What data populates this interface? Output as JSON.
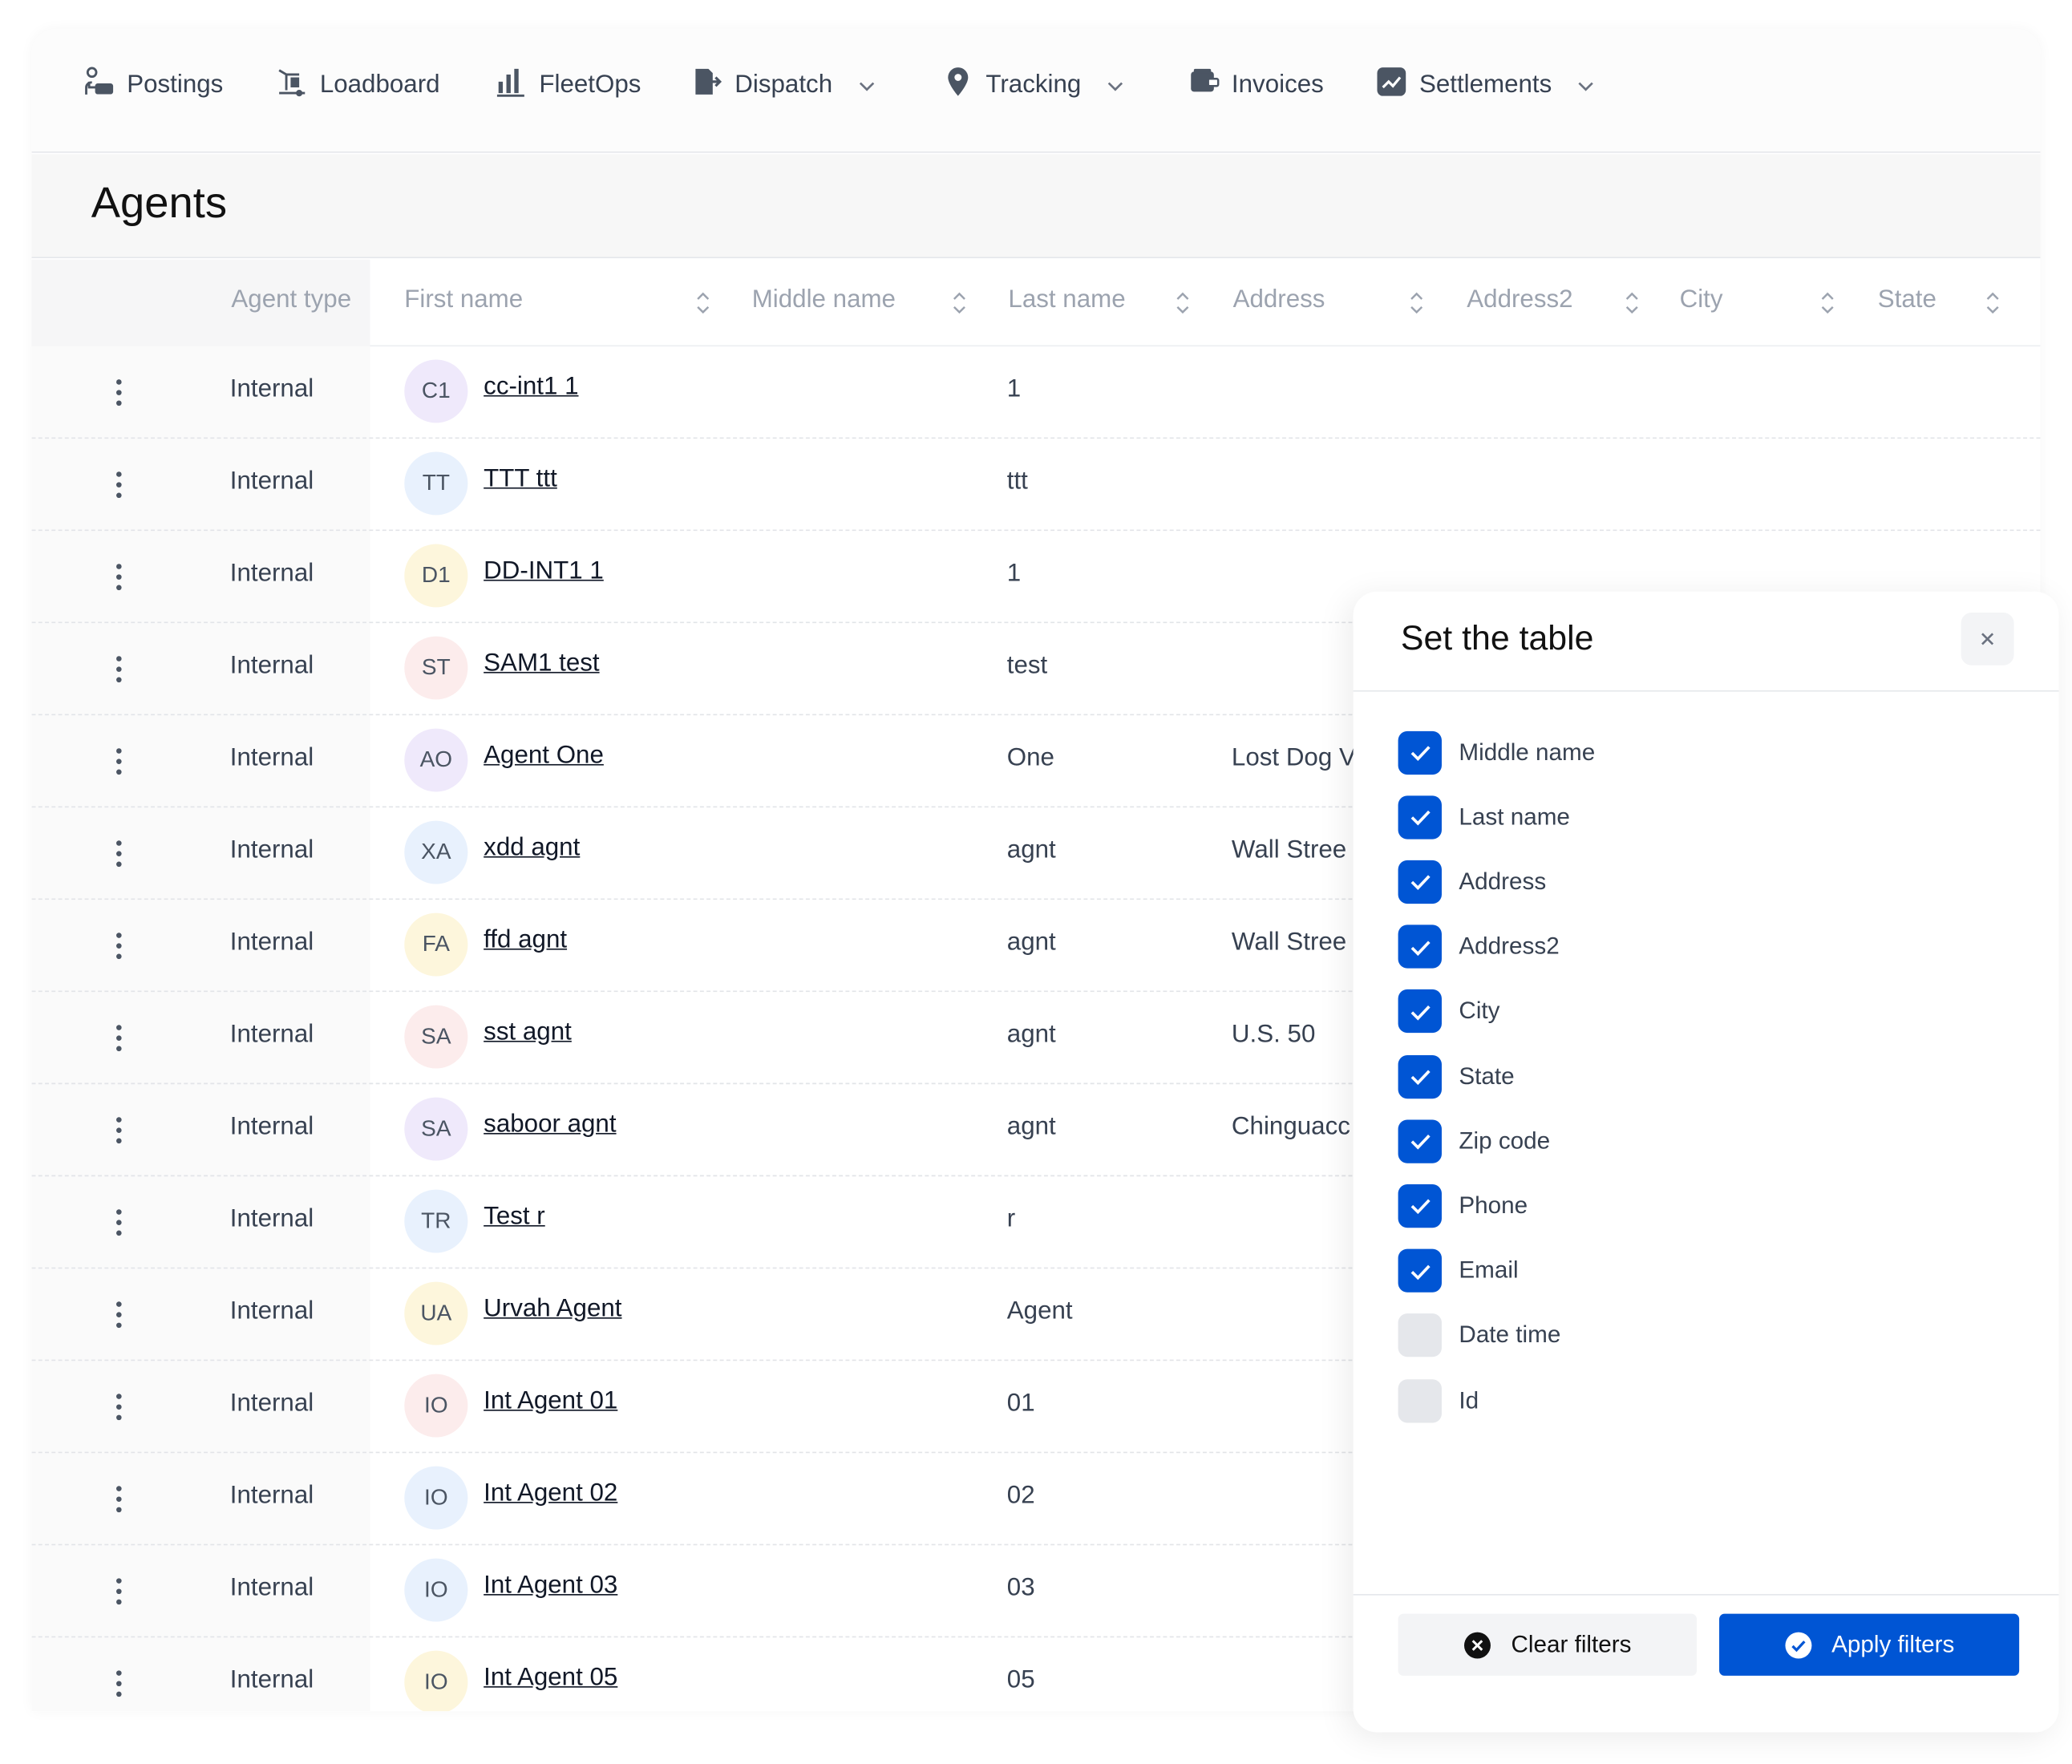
{
  "nav": {
    "items": [
      {
        "label": "Postings",
        "icon": "postings-icon",
        "dropdown": false
      },
      {
        "label": "Loadboard",
        "icon": "loadboard-icon",
        "dropdown": false
      },
      {
        "label": "FleetOps",
        "icon": "bar-chart-icon",
        "dropdown": false
      },
      {
        "label": "Dispatch",
        "icon": "dispatch-icon",
        "dropdown": true
      },
      {
        "label": "Tracking",
        "icon": "location-pin-icon",
        "dropdown": true
      },
      {
        "label": "Invoices",
        "icon": "invoice-icon",
        "dropdown": false
      },
      {
        "label": "Settlements",
        "icon": "settlements-icon",
        "dropdown": true
      }
    ]
  },
  "page": {
    "title": "Agents"
  },
  "table": {
    "columns": [
      "Agent type",
      "First name",
      "Middle name",
      "Last name",
      "Address",
      "Address2",
      "City",
      "State"
    ],
    "rows": [
      {
        "agent_type": "Internal",
        "initials": "C1",
        "first_name": "cc-int1 1",
        "last_name": "1",
        "address": ""
      },
      {
        "agent_type": "Internal",
        "initials": "TT",
        "first_name": "TTT ttt",
        "last_name": "ttt",
        "address": ""
      },
      {
        "agent_type": "Internal",
        "initials": "D1",
        "first_name": "DD-INT1 1",
        "last_name": "1",
        "address": ""
      },
      {
        "agent_type": "Internal",
        "initials": "ST",
        "first_name": "SAM1 test",
        "last_name": "test",
        "address": ""
      },
      {
        "agent_type": "Internal",
        "initials": "AO",
        "first_name": "Agent One",
        "last_name": "One",
        "address": "Lost Dog V"
      },
      {
        "agent_type": "Internal",
        "initials": "XA",
        "first_name": "xdd agnt",
        "last_name": "agnt",
        "address": "Wall Stree"
      },
      {
        "agent_type": "Internal",
        "initials": "FA",
        "first_name": "ffd agnt",
        "last_name": "agnt",
        "address": "Wall Stree"
      },
      {
        "agent_type": "Internal",
        "initials": "SA",
        "first_name": "sst agnt",
        "last_name": "agnt",
        "address": "U.S. 50"
      },
      {
        "agent_type": "Internal",
        "initials": "SA",
        "first_name": "saboor agnt",
        "last_name": "agnt",
        "address": "Chinguacc"
      },
      {
        "agent_type": "Internal",
        "initials": "TR",
        "first_name": "Test r",
        "last_name": "r",
        "address": ""
      },
      {
        "agent_type": "Internal",
        "initials": "UA",
        "first_name": "Urvah Agent",
        "last_name": "Agent",
        "address": ""
      },
      {
        "agent_type": "Internal",
        "initials": "IO",
        "first_name": "Int Agent 01",
        "last_name": "01",
        "address": ""
      },
      {
        "agent_type": "Internal",
        "initials": "IO",
        "first_name": "Int Agent 02",
        "last_name": "02",
        "address": ""
      },
      {
        "agent_type": "Internal",
        "initials": "IO",
        "first_name": "Int Agent 03",
        "last_name": "03",
        "address": ""
      },
      {
        "agent_type": "Internal",
        "initials": "IO",
        "first_name": "Int Agent 05",
        "last_name": "05",
        "address": ""
      }
    ]
  },
  "panel": {
    "title": "Set the table",
    "options": [
      {
        "label": "Middle name",
        "checked": true
      },
      {
        "label": "Last name",
        "checked": true
      },
      {
        "label": "Address",
        "checked": true
      },
      {
        "label": "Address2",
        "checked": true
      },
      {
        "label": "City",
        "checked": true
      },
      {
        "label": "State",
        "checked": true
      },
      {
        "label": "Zip code",
        "checked": true
      },
      {
        "label": "Phone",
        "checked": true
      },
      {
        "label": "Email",
        "checked": true
      },
      {
        "label": "Date time",
        "checked": false
      },
      {
        "label": "Id",
        "checked": false
      }
    ],
    "clear_label": "Clear filters",
    "apply_label": "Apply filters"
  },
  "colors": {
    "primary": "#0055d4",
    "avatar_bgs": [
      "#efe9fb",
      "#e8f1fd",
      "#fdf6dc",
      "#fcecec"
    ]
  }
}
